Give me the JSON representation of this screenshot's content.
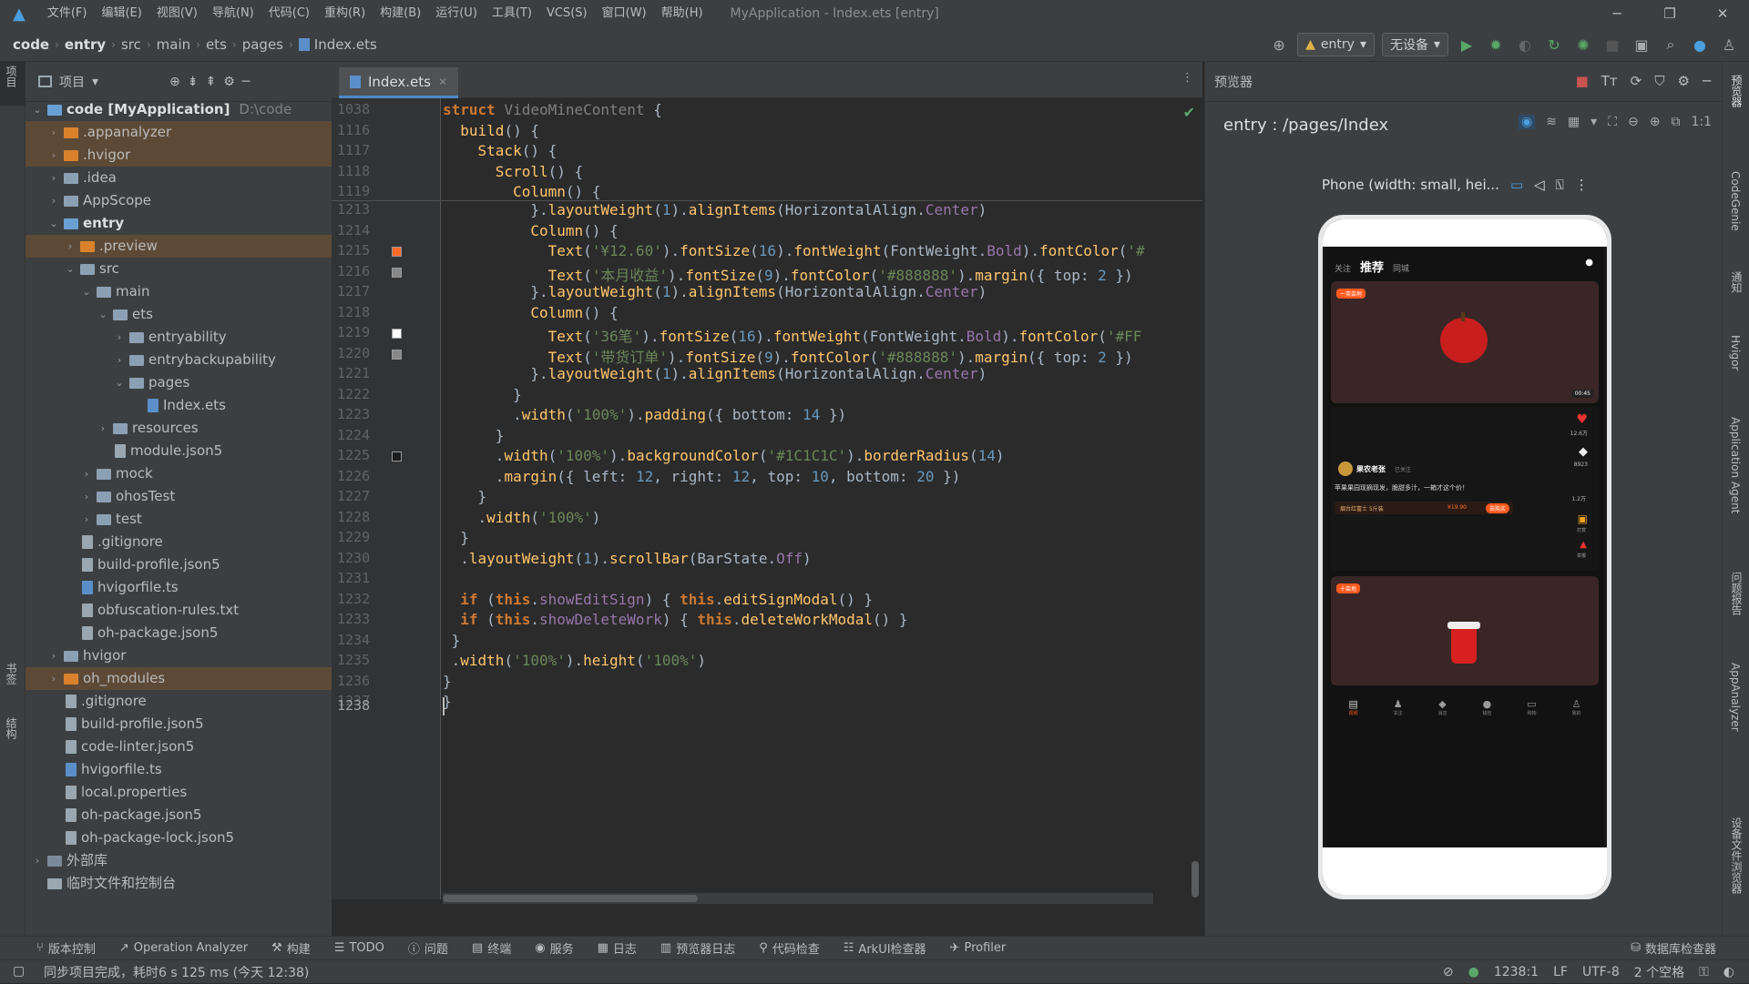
{
  "title_bar": {
    "menu": [
      "文件(F)",
      "编辑(E)",
      "视图(V)",
      "导航(N)",
      "代码(C)",
      "重构(R)",
      "构建(B)",
      "运行(U)",
      "工具(T)",
      "VCS(S)",
      "窗口(W)",
      "帮助(H)"
    ],
    "window_title": "MyApplication - Index.ets [entry]",
    "minimize": "─",
    "restore": "❐",
    "close": "✕"
  },
  "breadcrumb": {
    "items": [
      "code",
      "entry",
      "src",
      "main",
      "ets",
      "pages",
      "Index.ets"
    ]
  },
  "run_toolbar": {
    "config": "entry",
    "device": "无设备"
  },
  "left_strip": {
    "top": "项目",
    "bottom1": "书签",
    "bottom2": "结构"
  },
  "project": {
    "header": "项目",
    "tree": [
      {
        "depth": 0,
        "arrow": "⌄",
        "kind": "folder-blue",
        "label": "code [MyApplication]",
        "extra": "D:\\code",
        "bold": true
      },
      {
        "depth": 1,
        "arrow": "›",
        "kind": "folder-or",
        "label": ".appanalyzer",
        "hl": true
      },
      {
        "depth": 1,
        "arrow": "›",
        "kind": "folder-or",
        "label": ".hvigor",
        "hl": true
      },
      {
        "depth": 1,
        "arrow": "›",
        "kind": "folder",
        "label": ".idea"
      },
      {
        "depth": 1,
        "arrow": "›",
        "kind": "folder",
        "label": "AppScope"
      },
      {
        "depth": 1,
        "arrow": "⌄",
        "kind": "folder-blue",
        "label": "entry",
        "bold": true
      },
      {
        "depth": 2,
        "arrow": "›",
        "kind": "folder-or",
        "label": ".preview",
        "hl": true
      },
      {
        "depth": 2,
        "arrow": "⌄",
        "kind": "folder",
        "label": "src"
      },
      {
        "depth": 3,
        "arrow": "⌄",
        "kind": "folder",
        "label": "main"
      },
      {
        "depth": 4,
        "arrow": "⌄",
        "kind": "folder",
        "label": "ets"
      },
      {
        "depth": 5,
        "arrow": "›",
        "kind": "folder",
        "label": "entryability"
      },
      {
        "depth": 5,
        "arrow": "›",
        "kind": "folder",
        "label": "entrybackupability"
      },
      {
        "depth": 5,
        "arrow": "⌄",
        "kind": "folder",
        "label": "pages"
      },
      {
        "depth": 6,
        "arrow": "",
        "kind": "file-ts",
        "label": "Index.ets"
      },
      {
        "depth": 4,
        "arrow": "›",
        "kind": "folder",
        "label": "resources"
      },
      {
        "depth": 4,
        "arrow": "",
        "kind": "file",
        "label": "module.json5"
      },
      {
        "depth": 3,
        "arrow": "›",
        "kind": "folder",
        "label": "mock"
      },
      {
        "depth": 3,
        "arrow": "›",
        "kind": "folder",
        "label": "ohosTest"
      },
      {
        "depth": 3,
        "arrow": "›",
        "kind": "folder",
        "label": "test"
      },
      {
        "depth": 2,
        "arrow": "",
        "kind": "file",
        "label": ".gitignore"
      },
      {
        "depth": 2,
        "arrow": "",
        "kind": "file",
        "label": "build-profile.json5"
      },
      {
        "depth": 2,
        "arrow": "",
        "kind": "file-ts",
        "label": "hvigorfile.ts"
      },
      {
        "depth": 2,
        "arrow": "",
        "kind": "file",
        "label": "obfuscation-rules.txt"
      },
      {
        "depth": 2,
        "arrow": "",
        "kind": "file",
        "label": "oh-package.json5"
      },
      {
        "depth": 1,
        "arrow": "›",
        "kind": "folder",
        "label": "hvigor"
      },
      {
        "depth": 1,
        "arrow": "›",
        "kind": "folder-or",
        "label": "oh_modules",
        "hl": true
      },
      {
        "depth": 1,
        "arrow": "",
        "kind": "file",
        "label": ".gitignore"
      },
      {
        "depth": 1,
        "arrow": "",
        "kind": "file",
        "label": "build-profile.json5"
      },
      {
        "depth": 1,
        "arrow": "",
        "kind": "file",
        "label": "code-linter.json5"
      },
      {
        "depth": 1,
        "arrow": "",
        "kind": "file-ts",
        "label": "hvigorfile.ts"
      },
      {
        "depth": 1,
        "arrow": "",
        "kind": "file",
        "label": "local.properties"
      },
      {
        "depth": 1,
        "arrow": "",
        "kind": "file",
        "label": "oh-package.json5"
      },
      {
        "depth": 1,
        "arrow": "",
        "kind": "file",
        "label": "oh-package-lock.json5"
      },
      {
        "depth": 0,
        "arrow": "›",
        "kind": "lib",
        "label": "外部库"
      },
      {
        "depth": 0,
        "arrow": "",
        "kind": "scratch",
        "label": "临时文件和控制台"
      }
    ]
  },
  "editor": {
    "tab": "Index.ets",
    "lines": [
      {
        "n": "1038",
        "h": "<span class=\"kw\">struct</span> <span class=\"gr\">VideoMineContent</span> {",
        "m": ""
      },
      {
        "n": "1116",
        "h": "  <span class=\"fn\">build</span>() {",
        "m": ""
      },
      {
        "n": "1117",
        "h": "    <span class=\"fn\">Stack</span>() {",
        "m": ""
      },
      {
        "n": "1118",
        "h": "      <span class=\"fn\">Scroll</span>() {",
        "m": ""
      },
      {
        "n": "1119",
        "h": "        <span class=\"fn\">Column</span>() {",
        "m": ""
      },
      {
        "n": "1213",
        "h": "          }.<span class=\"fn\">layoutWeight</span>(<span class=\"nu\">1</span>).<span class=\"fn\">alignItems</span>(HorizontalAlign.<span class=\"pr\">Center</span>)",
        "m": ""
      },
      {
        "n": "1214",
        "h": "          <span class=\"fn\">Column</span>() {",
        "m": ""
      },
      {
        "n": "1215",
        "h": "            <span class=\"fn\">Text</span>(<span class=\"st\">'¥12.60'</span>).<span class=\"fn\">fontSize</span>(<span class=\"nu\">16</span>).<span class=\"fn\">fontWeight</span>(FontWeight.<span class=\"pr\">Bold</span>).<span class=\"fn\">fontColor</span>(<span class=\"st\">'#</span>",
        "m": "#ff6a2b"
      },
      {
        "n": "1216",
        "h": "            <span class=\"fn\">Text</span>(<span class=\"st\">'本月收益'</span>).<span class=\"fn\">fontSize</span>(<span class=\"nu\">9</span>).<span class=\"fn\">fontColor</span>(<span class=\"st\">'#888888'</span>).<span class=\"fn\">margin</span>({ top: <span class=\"nu\">2</span> })",
        "m": "#888888"
      },
      {
        "n": "1217",
        "h": "          }.<span class=\"fn\">layoutWeight</span>(<span class=\"nu\">1</span>).<span class=\"fn\">alignItems</span>(HorizontalAlign.<span class=\"pr\">Center</span>)",
        "m": ""
      },
      {
        "n": "1218",
        "h": "          <span class=\"fn\">Column</span>() {",
        "m": ""
      },
      {
        "n": "1219",
        "h": "            <span class=\"fn\">Text</span>(<span class=\"st\">'36笔'</span>).<span class=\"fn\">fontSize</span>(<span class=\"nu\">16</span>).<span class=\"fn\">fontWeight</span>(FontWeight.<span class=\"pr\">Bold</span>).<span class=\"fn\">fontColor</span>(<span class=\"st\">'#FF</span>",
        "m": "#ffffff"
      },
      {
        "n": "1220",
        "h": "            <span class=\"fn\">Text</span>(<span class=\"st\">'带货订单'</span>).<span class=\"fn\">fontSize</span>(<span class=\"nu\">9</span>).<span class=\"fn\">fontColor</span>(<span class=\"st\">'#888888'</span>).<span class=\"fn\">margin</span>({ top: <span class=\"nu\">2</span> })",
        "m": "#888888"
      },
      {
        "n": "1221",
        "h": "          }.<span class=\"fn\">layoutWeight</span>(<span class=\"nu\">1</span>).<span class=\"fn\">alignItems</span>(HorizontalAlign.<span class=\"pr\">Center</span>)",
        "m": ""
      },
      {
        "n": "1222",
        "h": "        }",
        "m": ""
      },
      {
        "n": "1223",
        "h": "        .<span class=\"fn\">width</span>(<span class=\"st\">'100%'</span>).<span class=\"fn\">padding</span>({ bottom: <span class=\"nu\">14</span> })",
        "m": ""
      },
      {
        "n": "1224",
        "h": "      }",
        "m": ""
      },
      {
        "n": "1225",
        "h": "      .<span class=\"fn\">width</span>(<span class=\"st\">'100%'</span>).<span class=\"fn\">backgroundColor</span>(<span class=\"st\">'#1C1C1C'</span>).<span class=\"fn\">borderRadius</span>(<span class=\"nu\">14</span>)",
        "m": "#1c1c1c"
      },
      {
        "n": "1226",
        "h": "      .<span class=\"fn\">margin</span>({ left: <span class=\"nu\">12</span>, right: <span class=\"nu\">12</span>, top: <span class=\"nu\">10</span>, bottom: <span class=\"nu\">20</span> })",
        "m": ""
      },
      {
        "n": "1227",
        "h": "    }",
        "m": ""
      },
      {
        "n": "1228",
        "h": "    .<span class=\"fn\">width</span>(<span class=\"st\">'100%'</span>)",
        "m": ""
      },
      {
        "n": "1229",
        "h": "  }",
        "m": ""
      },
      {
        "n": "1230",
        "h": "  .<span class=\"fn\">layoutWeight</span>(<span class=\"nu\">1</span>).<span class=\"fn\">scrollBar</span>(BarState.<span class=\"pr\">Off</span>)",
        "m": ""
      },
      {
        "n": "1231",
        "h": "",
        "m": ""
      },
      {
        "n": "1232",
        "h": "  <span class=\"kw\">if</span> (<span class=\"kw\">this</span>.<span class=\"pr\">showEditSign</span>) { <span class=\"kw\">this</span>.<span class=\"fn\">editSignModal</span>() }",
        "m": ""
      },
      {
        "n": "1233",
        "h": "  <span class=\"kw\">if</span> (<span class=\"kw\">this</span>.<span class=\"pr\">showDeleteWork</span>) { <span class=\"kw\">this</span>.<span class=\"fn\">deleteWorkModal</span>() }",
        "m": ""
      },
      {
        "n": "1234",
        "h": " }",
        "m": ""
      },
      {
        "n": "1235",
        "h": " .<span class=\"fn\">width</span>(<span class=\"st\">'100%'</span>).<span class=\"fn\">height</span>(<span class=\"st\">'100%'</span>)",
        "m": ""
      },
      {
        "n": "1236",
        "h": "}",
        "m": ""
      },
      {
        "n": "1237",
        "h": "}",
        "m": ""
      },
      {
        "n": "1238",
        "h": "",
        "m": ""
      }
    ]
  },
  "preview": {
    "header": "预览器",
    "route": "entry : /pages/Index",
    "device": "Phone (width: small, hei...",
    "app": {
      "tabs": [
        "关注",
        "推荐",
        "同城"
      ],
      "badge1": "一英亩地",
      "badge2": "十亩地",
      "timer": "00:45",
      "likes": "12.6万",
      "comments": "8923",
      "favs": "1.2万",
      "gift": "打赏",
      "report": "举报",
      "author": "果农老张",
      "follow": "已关注",
      "desc": "苹果果园现摘现发，脆甜多汁，一箱才这个价！",
      "product": "烟台红富士 5斤装",
      "price": "¥19.90",
      "buy": "去购买",
      "nav": [
        "视频",
        "关注",
        "消息",
        "钱包",
        "购物",
        "我的"
      ]
    }
  },
  "right_strip": [
    "预览器",
    "CodeGenie",
    "通知",
    "Hvigor",
    "Application Agent",
    "问题报告",
    "AppAnalyzer",
    "设备文件浏览器"
  ],
  "tool_windows": [
    "版本控制",
    "Operation Analyzer",
    "构建",
    "TODO",
    "问题",
    "终端",
    "服务",
    "日志",
    "预览器日志",
    "代码检查",
    "ArkUI检查器",
    "Profiler"
  ],
  "tool_right": "数据库检查器",
  "status": {
    "message": "同步项目完成，耗时6 s 125 ms (今天 12:38)",
    "position": "1238:1",
    "eol": "LF",
    "encoding": "UTF-8",
    "indent": "2 个空格"
  }
}
